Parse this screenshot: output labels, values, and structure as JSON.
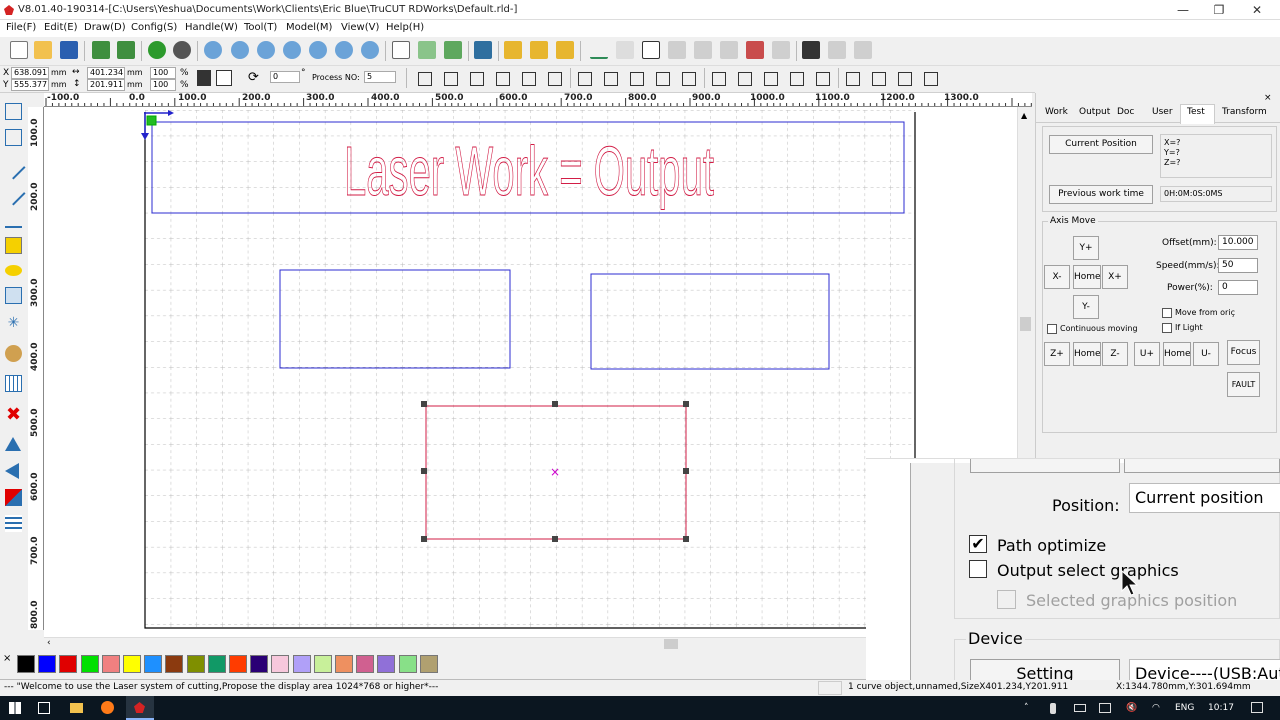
{
  "window": {
    "title": "V8.01.40-190314-[C:\\Users\\Yeshua\\Documents\\Work\\Clients\\Eric Blue\\TruCUT RDWorks\\Default.rld-]",
    "minimize": "—",
    "maximize": "❐",
    "close": "✕"
  },
  "menu": [
    "File(F)",
    "Edit(E)",
    "Draw(D)",
    "Config(S)",
    "Handle(W)",
    "Tool(T)",
    "Model(M)",
    "View(V)",
    "Help(H)"
  ],
  "coords": {
    "x_label": "X",
    "y_label": "Y",
    "x_value": "638.091",
    "y_value": "555.377",
    "unit": "mm",
    "width_value": "401.234",
    "height_value": "201.911",
    "scale_x": "100",
    "scale_y": "100",
    "pct": "%",
    "rotate_value": "0",
    "degree": "°",
    "process_label": "Process NO:",
    "process_value": "5"
  },
  "ruler": {
    "h_labels": [
      "-100.0",
      "0.0",
      "100.0",
      "200.0",
      "300.0",
      "400.0",
      "500.0",
      "600.0",
      "700.0",
      "800.0",
      "900.0",
      "1000.0",
      "1100.0",
      "1200.0",
      "1300.0"
    ],
    "v_labels": [
      "100.0",
      "200.0",
      "300.0",
      "400.0",
      "500.0",
      "600.0",
      "700.0",
      "800.0"
    ]
  },
  "canvas": {
    "headline": "Laser Work = Output"
  },
  "palette": {
    "close": "×",
    "colors": [
      "#000000",
      "#0000ff",
      "#e00000",
      "#00e000",
      "#f08080",
      "#ffff00",
      "#1e90ff",
      "#8b3a0f",
      "#7f8f00",
      "#119966",
      "#ff3c00",
      "#2a0075",
      "#f7c8dc",
      "#b0a0f8",
      "#c8f09a",
      "#ee9060",
      "#d06090",
      "#9070d8",
      "#88e088",
      "#b0a070"
    ]
  },
  "status": {
    "welcome": "--- \"Welcome to use the Laser system of cutting,Propose the display area 1024*768 or higher*---",
    "selection": "1 curve object,unnamed,SizeX401.234,Y201.911",
    "cursor": "X:1344.780mm,Y:301.694mm"
  },
  "taskbar": {
    "lang": "ENG",
    "time": "10:17"
  },
  "panel": {
    "tabs": [
      "Work",
      "Output",
      "Doc",
      "User",
      "Test",
      "Transform"
    ],
    "active_tab": "Test",
    "current_position_btn": "Current Position",
    "xyz": [
      "X=?",
      "Y=?",
      "Z=?"
    ],
    "previous_work_btn": "Previous work time",
    "previous_work_value": "0H:0M:0S:0MS",
    "axis_move_title": "Axis Move",
    "yplus": "Y+",
    "xminus": "X-",
    "home": "Home",
    "xplus": "X+",
    "yminus": "Y-",
    "offset_label": "Offset(mm):",
    "offset_value": "10.000",
    "speed_label": "Speed(mm/s):",
    "speed_value": "50",
    "power_label": "Power(%):",
    "power_value": "0",
    "move_from_origin": "Move from oriç",
    "continuous_moving": "Continuous moving",
    "if_light": "If Light",
    "zplus": "Z+",
    "zminus": "Z-",
    "uplus": "U+",
    "uminus": "U-",
    "focus": "Focus",
    "fault": "FAULT"
  },
  "zoom": {
    "position_label": "Position:",
    "position_value": "Current position",
    "path_optimize": "Path optimize",
    "output_select_graphics": "Output select graphics",
    "selected_graphics_position": "Selected graphics position",
    "device_title": "Device",
    "setting_btn": "Setting",
    "device_value": "Device----(USB:Aut"
  }
}
